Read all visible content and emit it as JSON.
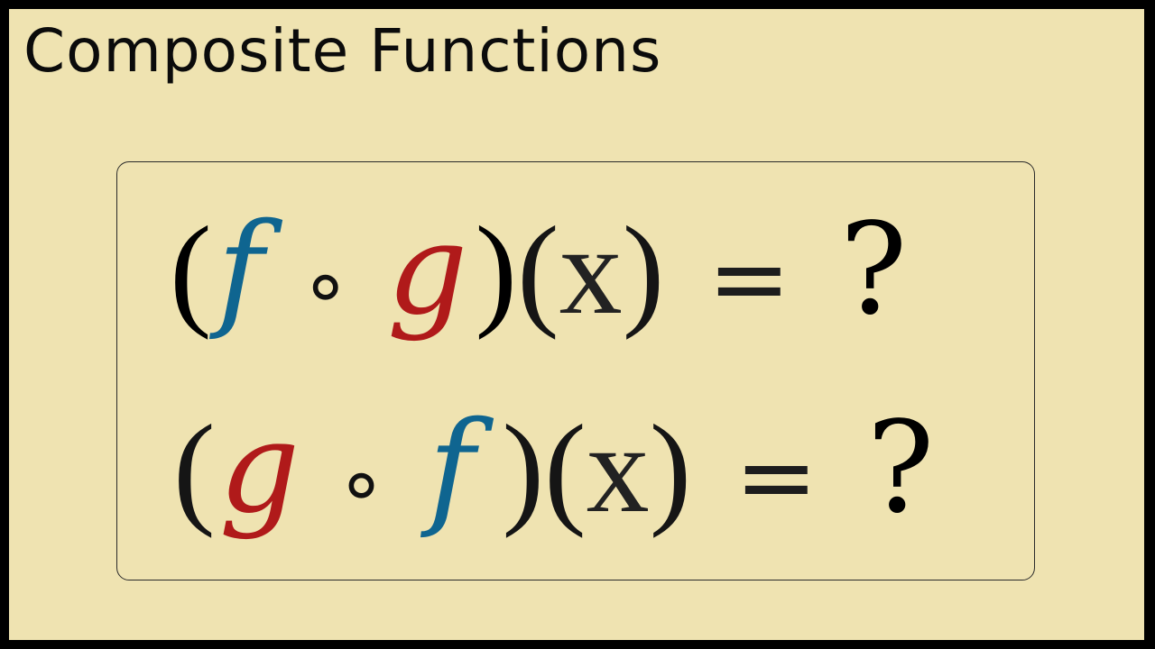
{
  "title": "Composite Functions",
  "formulas": [
    {
      "open_paren": "(",
      "first_fn": "f",
      "compose_op": "∘",
      "second_fn": "g",
      "close_paren": ")",
      "arg_open": "(",
      "arg": "x",
      "arg_close": ")",
      "equals": "=",
      "result": "?"
    },
    {
      "open_paren": "(",
      "first_fn": "g",
      "compose_op": "∘",
      "second_fn": "f",
      "close_paren": ")",
      "arg_open": "(",
      "arg": "x",
      "arg_close": ")",
      "equals": "=",
      "result": "?"
    }
  ],
  "colors": {
    "background": "#efe3b1",
    "frame": "#000000",
    "f_color": "#0f6590",
    "g_color": "#b01a1a"
  }
}
